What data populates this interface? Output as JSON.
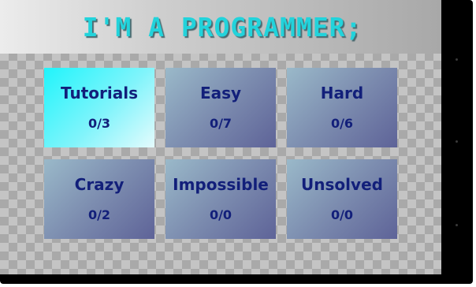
{
  "header": {
    "title": "I'M A PROGRAMMER;"
  },
  "categories": [
    {
      "name": "Tutorials",
      "progress": "0/3",
      "selected": true
    },
    {
      "name": "Easy",
      "progress": "0/7",
      "selected": false
    },
    {
      "name": "Hard",
      "progress": "0/6",
      "selected": false
    },
    {
      "name": "Crazy",
      "progress": "0/2",
      "selected": false
    },
    {
      "name": "Impossible",
      "progress": "0/0",
      "selected": false
    },
    {
      "name": "Unsolved",
      "progress": "0/0",
      "selected": false
    }
  ],
  "colors": {
    "title": "#22d3db",
    "tile_text": "#121f7a",
    "tile_selected": "#20f4fb",
    "tile_normal": "#7c8caf"
  }
}
